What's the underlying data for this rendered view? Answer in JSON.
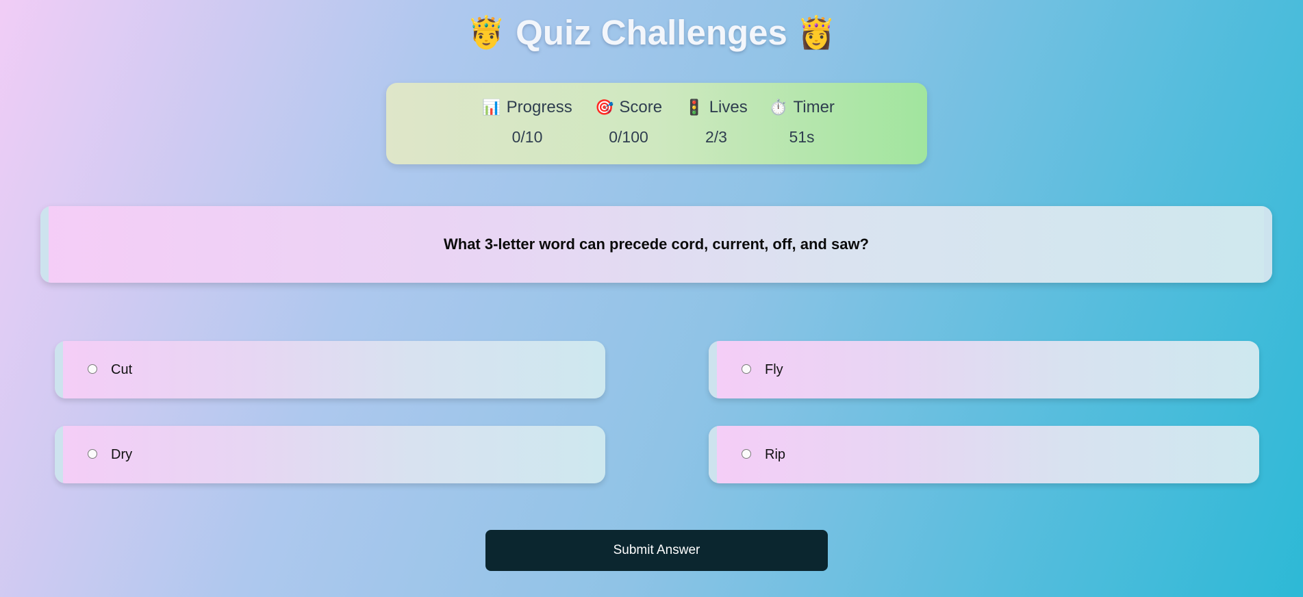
{
  "header": {
    "title": "Quiz Challenges",
    "left_icon": "prince-emoji",
    "right_icon": "princess-emoji",
    "left_glyph": "🤴",
    "right_glyph": "👸"
  },
  "stats": {
    "progress": {
      "label": "Progress",
      "value": "0/10",
      "icon": "bar-chart-icon",
      "glyph": "📊"
    },
    "score": {
      "label": "Score",
      "value": "0/100",
      "icon": "target-icon",
      "glyph": "🎯"
    },
    "lives": {
      "label": "Lives",
      "value": "2/3",
      "icon": "traffic-light-icon",
      "glyph": "🚦"
    },
    "timer": {
      "label": "Timer",
      "value": "51s",
      "icon": "stopwatch-icon",
      "glyph": "⏱️"
    }
  },
  "question": {
    "text": "What 3-letter word can precede cord, current, off, and saw?"
  },
  "options": [
    {
      "label": "Cut"
    },
    {
      "label": "Fly"
    },
    {
      "label": "Dry"
    },
    {
      "label": "Rip"
    }
  ],
  "submit": {
    "label": "Submit Answer"
  },
  "colors": {
    "submit_bg": "#0b262f",
    "stats_bg_end": "#a1e59e",
    "title_text": "#f3f6fb"
  }
}
